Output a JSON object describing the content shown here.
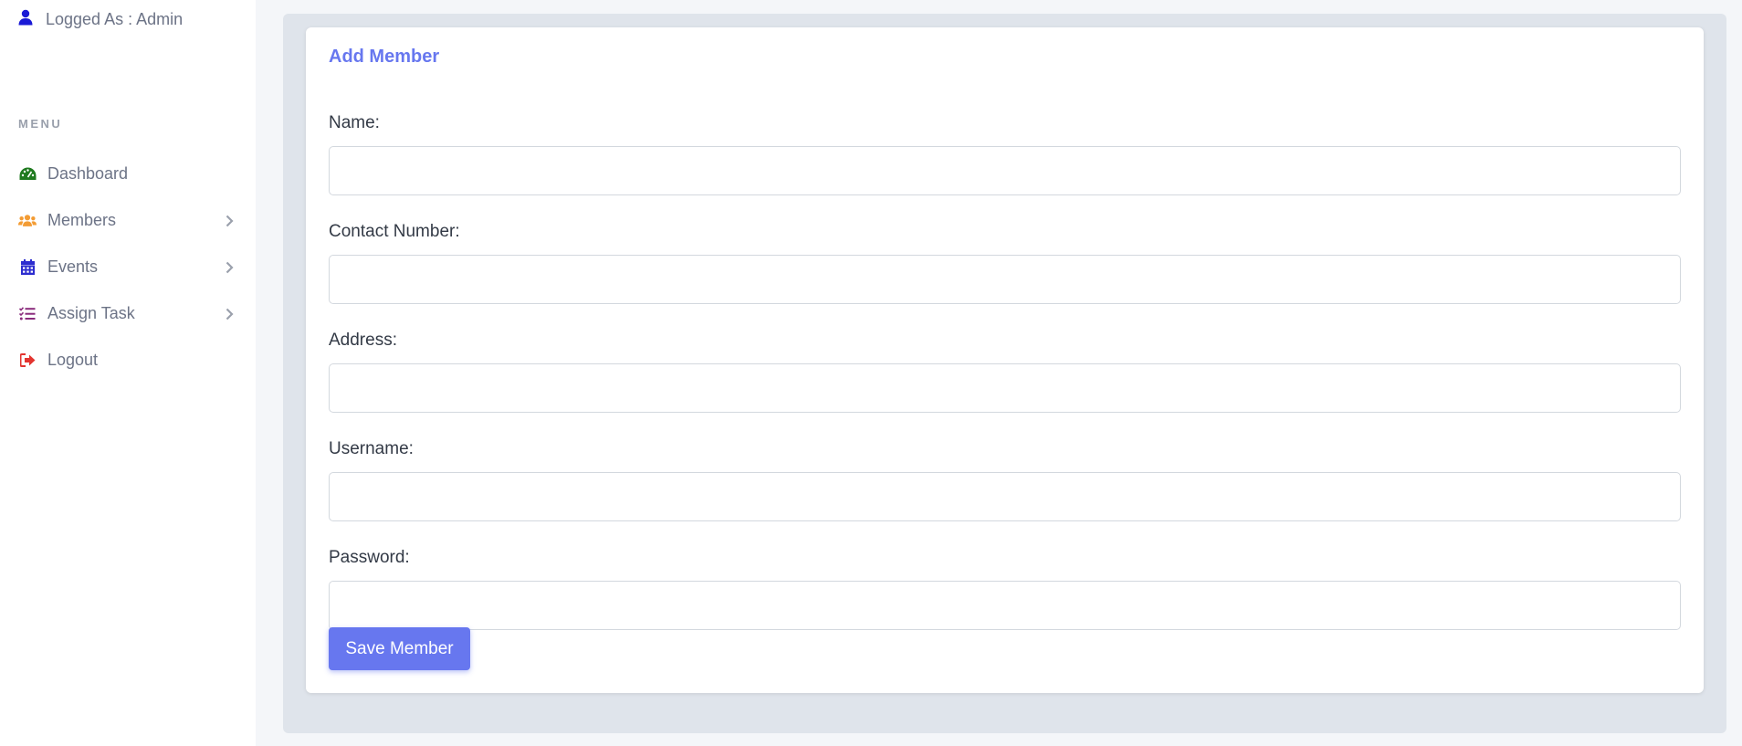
{
  "sidebar": {
    "user_label": "Logged As : Admin",
    "menu_heading": "MENU",
    "items": [
      {
        "label": "Dashboard",
        "icon": "gauge-icon",
        "color": "#1f7a1f",
        "has_chevron": false
      },
      {
        "label": "Members",
        "icon": "users-icon",
        "color": "#f39c34",
        "has_chevron": true
      },
      {
        "label": "Events",
        "icon": "calendar-icon",
        "color": "#2d2dcf",
        "has_chevron": true
      },
      {
        "label": "Assign Task",
        "icon": "tasks-icon",
        "color": "#8a2b7c",
        "has_chevron": true
      },
      {
        "label": "Logout",
        "icon": "sign-out-icon",
        "color": "#e3342f",
        "has_chevron": false
      }
    ]
  },
  "form": {
    "title": "Add Member",
    "fields": [
      {
        "label": "Name:",
        "value": "",
        "placeholder": ""
      },
      {
        "label": "Contact Number:",
        "value": "",
        "placeholder": ""
      },
      {
        "label": "Address:",
        "value": "",
        "placeholder": ""
      },
      {
        "label": "Username:",
        "value": "",
        "placeholder": ""
      },
      {
        "label": "Password:",
        "value": "",
        "placeholder": ""
      }
    ],
    "submit_label": "Save Member"
  },
  "colors": {
    "accent": "#6777ef",
    "user_icon": "#1a1ad6"
  }
}
